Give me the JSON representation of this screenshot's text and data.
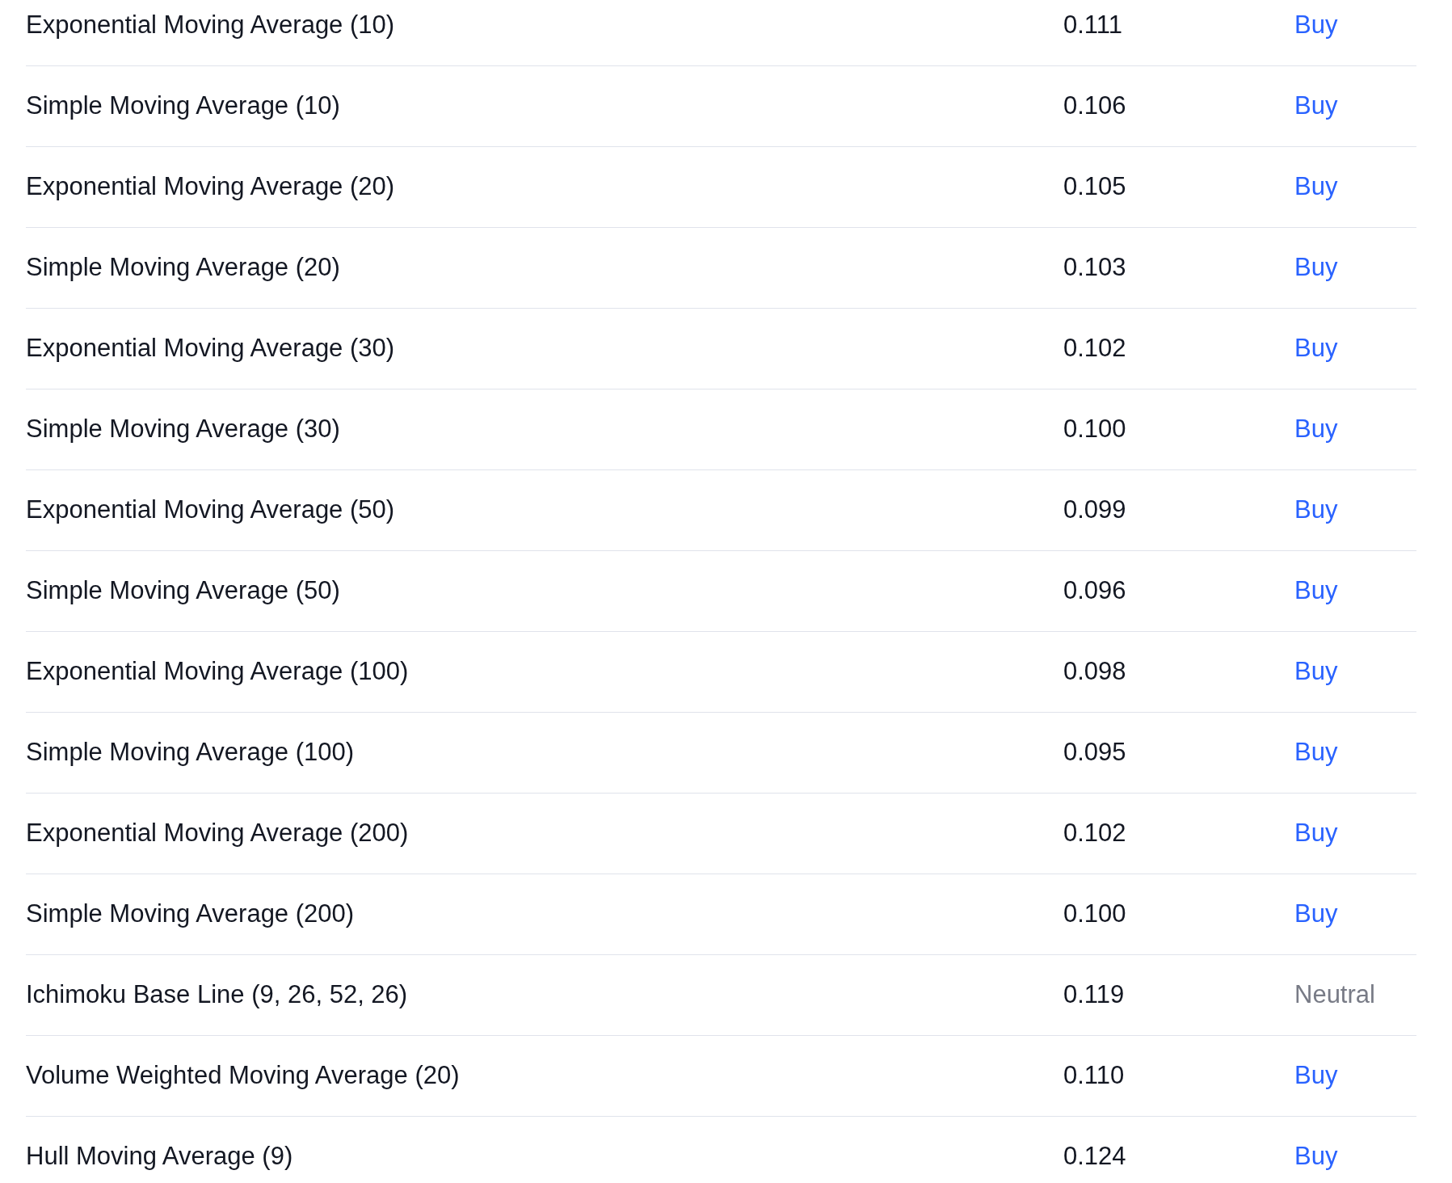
{
  "rows": [
    {
      "name": "Exponential Moving Average (10)",
      "value": "0.111",
      "signal": "Buy",
      "kind": "buy"
    },
    {
      "name": "Simple Moving Average (10)",
      "value": "0.106",
      "signal": "Buy",
      "kind": "buy"
    },
    {
      "name": "Exponential Moving Average (20)",
      "value": "0.105",
      "signal": "Buy",
      "kind": "buy"
    },
    {
      "name": "Simple Moving Average (20)",
      "value": "0.103",
      "signal": "Buy",
      "kind": "buy"
    },
    {
      "name": "Exponential Moving Average (30)",
      "value": "0.102",
      "signal": "Buy",
      "kind": "buy"
    },
    {
      "name": "Simple Moving Average (30)",
      "value": "0.100",
      "signal": "Buy",
      "kind": "buy"
    },
    {
      "name": "Exponential Moving Average (50)",
      "value": "0.099",
      "signal": "Buy",
      "kind": "buy"
    },
    {
      "name": "Simple Moving Average (50)",
      "value": "0.096",
      "signal": "Buy",
      "kind": "buy"
    },
    {
      "name": "Exponential Moving Average (100)",
      "value": "0.098",
      "signal": "Buy",
      "kind": "buy"
    },
    {
      "name": "Simple Moving Average (100)",
      "value": "0.095",
      "signal": "Buy",
      "kind": "buy"
    },
    {
      "name": "Exponential Moving Average (200)",
      "value": "0.102",
      "signal": "Buy",
      "kind": "buy"
    },
    {
      "name": "Simple Moving Average (200)",
      "value": "0.100",
      "signal": "Buy",
      "kind": "buy"
    },
    {
      "name": "Ichimoku Base Line (9, 26, 52, 26)",
      "value": "0.119",
      "signal": "Neutral",
      "kind": "neutral"
    },
    {
      "name": "Volume Weighted Moving Average (20)",
      "value": "0.110",
      "signal": "Buy",
      "kind": "buy"
    },
    {
      "name": "Hull Moving Average (9)",
      "value": "0.124",
      "signal": "Buy",
      "kind": "buy"
    }
  ]
}
